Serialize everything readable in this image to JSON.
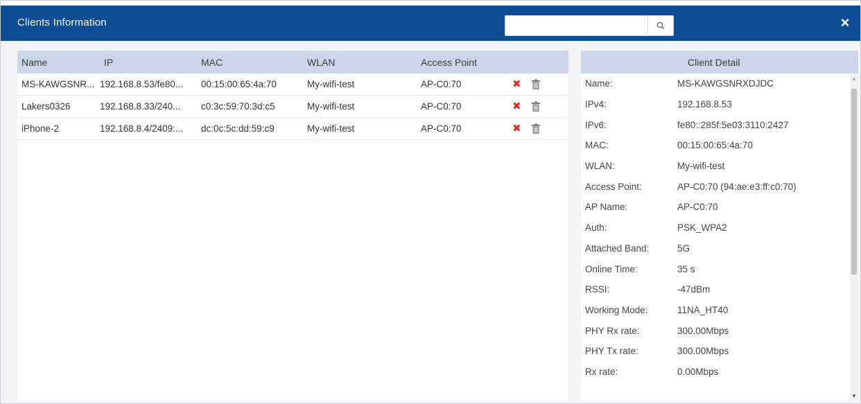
{
  "dialog": {
    "title": "Clients Information",
    "search": {
      "placeholder": "",
      "value": ""
    },
    "close_label": "×"
  },
  "client_list": {
    "columns": [
      "Name",
      "IP",
      "MAC",
      "WLAN",
      "Access Point"
    ],
    "rows": [
      {
        "name": "MS-KAWGSNR...",
        "ip": "192.168.8.53/fe80...",
        "mac": "00:15:00:65:4a:70",
        "wlan": "My-wifi-test",
        "ap": "AP-C0:70"
      },
      {
        "name": "Lakers0326",
        "ip": "192.168.8.33/240...",
        "mac": "c0:3c:59:70:3d:c5",
        "wlan": "My-wifi-test",
        "ap": "AP-C0:70"
      },
      {
        "name": "iPhone-2",
        "ip": "192.168.8.4/2409:...",
        "mac": "dc:0c:5c:dd:59:c9",
        "wlan": "My-wifi-test",
        "ap": "AP-C0:70"
      }
    ],
    "row_actions": {
      "remove_icon": "red-x-icon",
      "delete_icon": "trash-icon",
      "remove_color": "#dd2a2a"
    }
  },
  "client_detail": {
    "title": "Client Detail",
    "fields": [
      {
        "label": "Name:",
        "value": "MS-KAWGSNRXDJDC"
      },
      {
        "label": "IPv4:",
        "value": "192.168.8.53"
      },
      {
        "label": "IPv6:",
        "value": "fe80::285f:5e03:3110:2427"
      },
      {
        "label": "MAC:",
        "value": "00:15:00:65:4a:70"
      },
      {
        "label": "WLAN:",
        "value": "My-wifi-test"
      },
      {
        "label": "Access Point:",
        "value": "AP-C0:70 (94:ae:e3:ff:c0:70)"
      },
      {
        "label": "AP Name:",
        "value": "AP-C0:70"
      },
      {
        "label": "Auth:",
        "value": "PSK_WPA2"
      },
      {
        "label": "Attached Band:",
        "value": "5G"
      },
      {
        "label": "Online Time:",
        "value": "35 s"
      },
      {
        "label": "RSSI:",
        "value": "-47dBm"
      },
      {
        "label": "Working Mode:",
        "value": "11NA_HT40"
      },
      {
        "label": "PHY Rx rate:",
        "value": "300.00Mbps"
      },
      {
        "label": "PHY Tx rate:",
        "value": "300.00Mbps"
      },
      {
        "label": "Rx rate:",
        "value": "0.00Mbps"
      }
    ]
  },
  "colors": {
    "titlebar": "#0c4d96",
    "table_header": "#ccd5ea",
    "dialog_background": "#f3f4f6"
  }
}
